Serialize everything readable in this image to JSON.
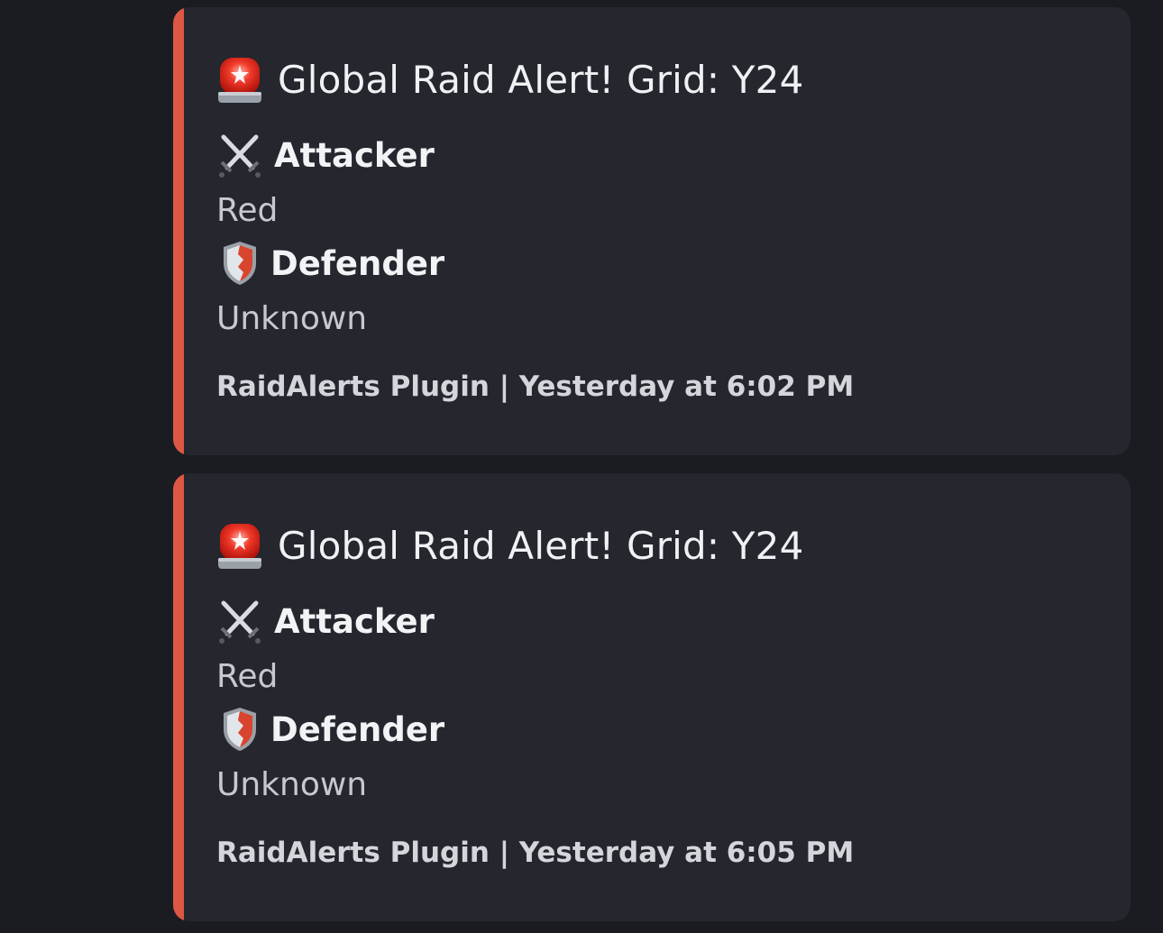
{
  "embeds": [
    {
      "title": "Global Raid Alert! Grid: Y24",
      "title_icon": "siren-icon",
      "fields": [
        {
          "name": "Attacker",
          "icon": "crossed-swords-icon",
          "value": "Red"
        },
        {
          "name": "Defender",
          "icon": "shield-icon",
          "value": "Unknown"
        }
      ],
      "footer": "RaidAlerts Plugin | Yesterday at 6:02 PM"
    },
    {
      "title": "Global Raid Alert! Grid: Y24",
      "title_icon": "siren-icon",
      "fields": [
        {
          "name": "Attacker",
          "icon": "crossed-swords-icon",
          "value": "Red"
        },
        {
          "name": "Defender",
          "icon": "shield-icon",
          "value": "Unknown"
        }
      ],
      "footer": "RaidAlerts Plugin | Yesterday at 6:05 PM"
    }
  ],
  "colors": {
    "background": "#1b1c21",
    "embed_background": "#25262e",
    "accent_bar": "#dc5844"
  }
}
